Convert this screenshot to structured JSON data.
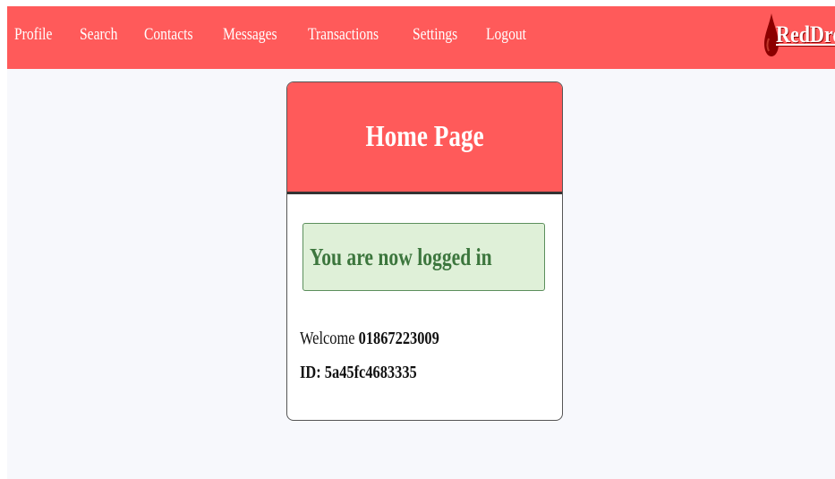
{
  "colors": {
    "brand_red": "#ff5a5a",
    "page_bg": "#f7f8fc",
    "alert_bg": "#dff0d8",
    "alert_text": "#3c763d"
  },
  "nav": {
    "items": [
      {
        "label": "Profile"
      },
      {
        "label": "Search"
      },
      {
        "label": "Contacts"
      },
      {
        "label": "Messages"
      },
      {
        "label": "Transactions"
      },
      {
        "label": "Settings"
      },
      {
        "label": "Logout"
      }
    ],
    "brand": {
      "text": "RedDrop",
      "icon": "blood-drop-icon"
    }
  },
  "card": {
    "title": "Home Page",
    "alert": "You are now logged in",
    "welcome_label": "Welcome",
    "welcome_user": "01867223009",
    "id_label": "ID:",
    "id_value": "5a45fc4683335"
  }
}
